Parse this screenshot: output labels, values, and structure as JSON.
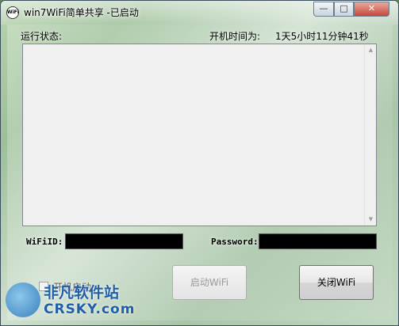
{
  "window": {
    "title": "win7WiFi简单共享 -已启动",
    "app_icon_text": "WiFi"
  },
  "status": {
    "label": "运行状态:",
    "uptime_label": "开机时间为:",
    "uptime_value": "1天5小时11分钟41秒"
  },
  "wifi": {
    "id_label": "WiFiID:",
    "id_value": "",
    "password_label": "Password:",
    "password_value": ""
  },
  "options": {
    "autostart_label": "开机启动"
  },
  "buttons": {
    "start_label": "启动WiFi",
    "stop_label": "关闭WiFi"
  },
  "watermark": {
    "cn": "非凡软件站",
    "en": "CRSKY.com"
  }
}
